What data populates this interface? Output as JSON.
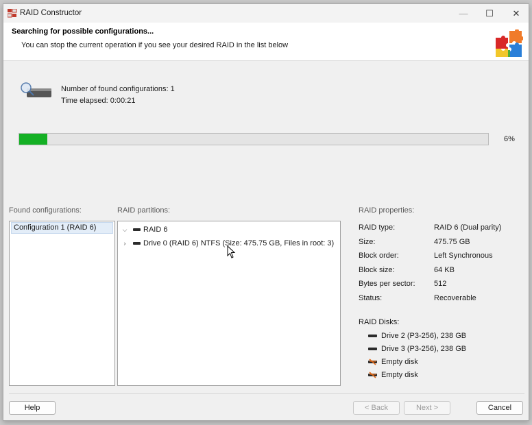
{
  "window": {
    "title": "RAID Constructor",
    "minimize": "—",
    "maximize": "☐",
    "close": "✕"
  },
  "header": {
    "title": "Searching for possible configurations...",
    "subtitle": "You can stop the current operation if you see your desired RAID in the list below"
  },
  "status": {
    "found_count": "Number of found configurations: 1",
    "elapsed": "Time elapsed: 0:00:21"
  },
  "progress": {
    "value": 0.06,
    "label": "6%",
    "color": "#14b024"
  },
  "found": {
    "label": "Found configurations:",
    "items": [
      "Configuration 1 (RAID 6)"
    ]
  },
  "partitions": {
    "label": "RAID partitions:",
    "rows": [
      {
        "chevron": "⌵",
        "text": "RAID 6"
      },
      {
        "chevron": "›",
        "text": "Drive 0 (RAID 6) NTFS (Size: 475.75 GB, Files in root: 3)"
      }
    ]
  },
  "properties": {
    "label": "RAID properties:",
    "items": [
      {
        "key": "RAID type:",
        "value": "RAID 6 (Dual parity)"
      },
      {
        "key": "Size:",
        "value": "475.75 GB"
      },
      {
        "key": "Block order:",
        "value": "Left Synchronous"
      },
      {
        "key": "Block size:",
        "value": "64 KB"
      },
      {
        "key": "Bytes per sector:",
        "value": "512"
      },
      {
        "key": "Status:",
        "value": "Recoverable"
      }
    ],
    "disks_label": "RAID Disks:",
    "disks": [
      {
        "text": "Drive 2 (P3-256), 238 GB",
        "icon": "drive-icon"
      },
      {
        "text": "Drive 3 (P3-256), 238 GB",
        "icon": "drive-icon"
      },
      {
        "text": "Empty disk",
        "icon": "empty-disk-icon"
      },
      {
        "text": "Empty disk",
        "icon": "empty-disk-icon"
      }
    ]
  },
  "buttons": {
    "help": "Help",
    "back": "< Back",
    "next": "Next >",
    "cancel": "Cancel"
  }
}
